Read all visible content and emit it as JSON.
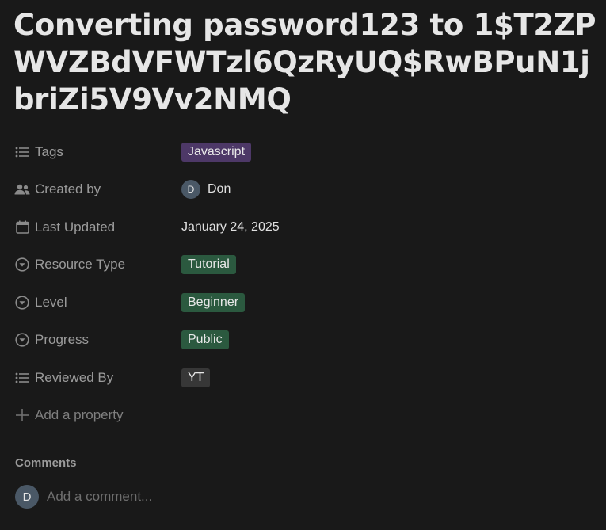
{
  "page": {
    "title": "Converting password123 to 1$T2ZPWVZBdVFWTzl6QzRyUQ$RwBPuN1jbriZi5V9Vv2NMQ"
  },
  "properties": {
    "tags": {
      "label": "Tags",
      "icon": "list-icon",
      "value": "Javascript",
      "color": "#4d3867"
    },
    "created_by": {
      "label": "Created by",
      "icon": "people-icon",
      "avatar_initial": "D",
      "value": "Don"
    },
    "last_updated": {
      "label": "Last Updated",
      "icon": "calendar-icon",
      "value": "January 24, 2025"
    },
    "resource_type": {
      "label": "Resource Type",
      "icon": "select-icon",
      "value": "Tutorial",
      "color": "#2b593f"
    },
    "level": {
      "label": "Level",
      "icon": "select-icon",
      "value": "Beginner",
      "color": "#2b593f"
    },
    "progress": {
      "label": "Progress",
      "icon": "select-icon",
      "value": "Public",
      "color": "#2b593f"
    },
    "reviewed_by": {
      "label": "Reviewed By",
      "icon": "list-icon",
      "value": "YT",
      "color": "#373737"
    },
    "add_property": {
      "label": "Add a property",
      "icon": "plus-icon"
    }
  },
  "comments": {
    "heading": "Comments",
    "avatar_initial": "D",
    "placeholder": "Add a comment..."
  }
}
